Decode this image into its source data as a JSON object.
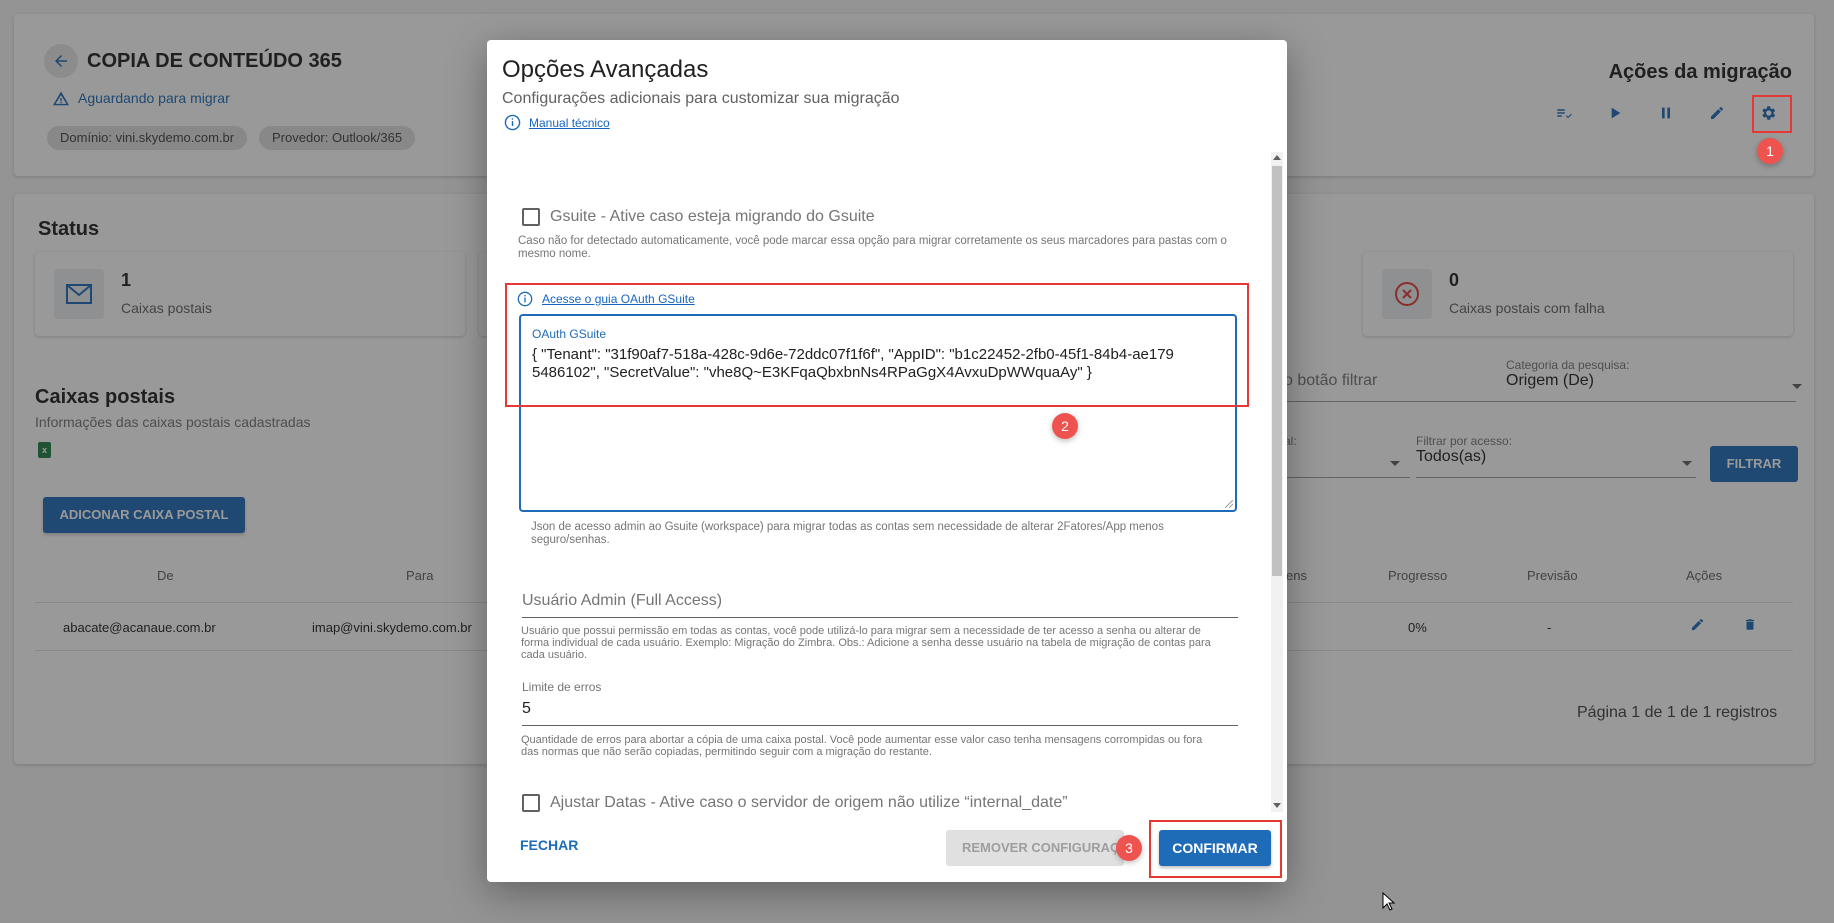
{
  "header": {
    "title": "COPIA DE CONTEÚDO 365",
    "status": "Aguardando para migrar",
    "chips": [
      "Domínio: vini.skydemo.com.br",
      "Provedor: Outlook/365"
    ],
    "actions_title": "Ações da migração"
  },
  "status": {
    "title": "Status",
    "cards": [
      {
        "value": "1",
        "label": "Caixas postais"
      },
      {
        "value": "0",
        "label": "Caixas postais com falha"
      }
    ]
  },
  "mailboxes": {
    "title": "Caixas postais",
    "subtitle": "Informações das caixas postais cadastradas",
    "add_button": "ADICONAR CAIXA POSTAL",
    "search_placeholder_fragment": "o botão filtrar",
    "search_category_label": "Categoria da pesquisa:",
    "search_category_value": "Origem (De)",
    "filter_status_label_fragment": "al:",
    "filter_access_label": "Filtrar por acesso:",
    "filter_access_value": "Todos(as)",
    "filter_button": "FILTRAR",
    "columns": {
      "from": "De",
      "to": "Para",
      "messages_fragment": "ens",
      "progress": "Progresso",
      "forecast": "Previsão",
      "actions": "Ações"
    },
    "rows": [
      {
        "from": "abacate@acanaue.com.br",
        "to": "imap@vini.skydemo.com.br",
        "progress": "0%",
        "forecast": "-"
      }
    ],
    "pagination": "Página 1 de 1 de 1 registros"
  },
  "dialog": {
    "title": "Opções Avançadas",
    "subtitle": "Configurações adicionais para customizar sua migração",
    "manual_link": "Manual técnico",
    "gsuite_checkbox_label": "Gsuite - Ative caso esteja migrando do Gsuite",
    "gsuite_hint": "Caso não for detectado automaticamente, você pode marcar essa opção para migrar corretamente os seus marcadores para pastas com o mesmo nome.",
    "oauth_link": "Acesse o guia OAuth GSuite",
    "oauth_label": "OAuth GSuite",
    "oauth_value": "{ \"Tenant\": \"31f90af7-518a-428c-9d6e-72ddc07f1f6f\", \"AppID\": \"b1c22452-2fb0-45f1-84b4-ae1795486102\", \"SecretValue\": \"vhe8Q~E3KFqaQbxbnNs4RPaGgX4AvxuDpWWquaAy\" }",
    "oauth_hint": "Json de acesso admin ao Gsuite (workspace) para migrar todas as contas sem necessidade de alterar 2Fatores/App menos seguro/senhas.",
    "admin_placeholder": "Usuário Admin (Full Access)",
    "admin_hint": "Usuário que possui permissão em todas as contas, você pode utilizá-lo para migrar sem a necessidade de ter acesso a senha ou alterar de forma individual de cada usuário. Exemplo: Migração do Zimbra. Obs.: Adicione a senha desse usuário na tabela de migração de contas para cada usuário.",
    "error_limit_label": "Limite de erros",
    "error_limit_value": "5",
    "error_limit_hint": "Quantidade de erros para abortar a cópia de uma caixa postal. Você pode aumentar esse valor caso tenha mensagens corrompidas ou fora das normas que não serão copiadas, permitindo seguir com a migração do restante.",
    "adjust_dates_label": "Ajustar Datas - Ative caso o servidor de origem não utilize “internal_date”",
    "close_button": "FECHAR",
    "remove_button": "REMOVER CONFIGURAÇ",
    "confirm_button": "CONFIRMAR"
  },
  "annotations": [
    "1",
    "2",
    "3"
  ],
  "colors": {
    "primary": "#1e6bb8",
    "annotation": "#e53935",
    "badge": "#ef5350"
  }
}
